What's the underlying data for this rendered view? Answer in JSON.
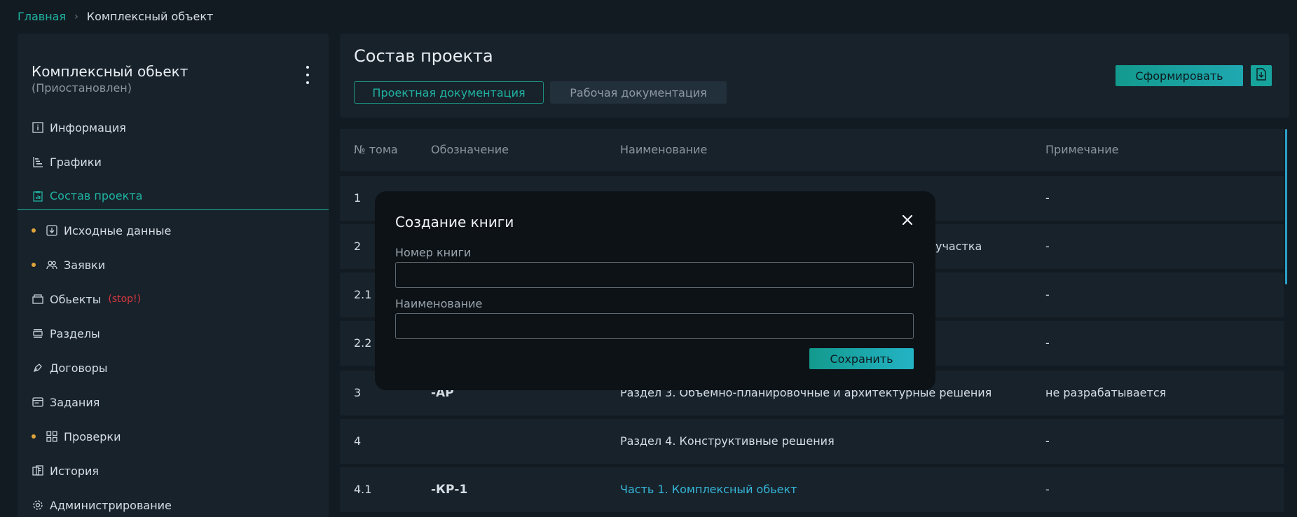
{
  "breadcrumb": {
    "home": "Главная",
    "separator": "›",
    "current": "Комплексный объект"
  },
  "sidebar": {
    "title": "Комплексный обьект",
    "status": "(Приостановлен)",
    "items": [
      {
        "label": "Информация",
        "icon": "info-icon"
      },
      {
        "label": "Графики",
        "icon": "gantt-icon"
      },
      {
        "label": "Состав проекта",
        "icon": "clipboard-icon",
        "active": true
      },
      {
        "label": "Исходные данные",
        "icon": "download-box-icon",
        "dot": true
      },
      {
        "label": "Заявки",
        "icon": "users-icon",
        "dot": true
      },
      {
        "label": "Обьекты",
        "icon": "box-icon",
        "badge": "(stop!)"
      },
      {
        "label": "Разделы",
        "icon": "sections-icon"
      },
      {
        "label": "Договоры",
        "icon": "pen-icon"
      },
      {
        "label": "Задания",
        "icon": "tasks-icon"
      },
      {
        "label": "Проверки",
        "icon": "grid-icon",
        "dot": true
      },
      {
        "label": "История",
        "icon": "history-icon"
      },
      {
        "label": "Администрирование",
        "icon": "gear-icon"
      }
    ]
  },
  "main": {
    "title": "Состав проекта",
    "tabs": [
      "Проектная документация",
      "Рабочая документация"
    ],
    "form_button": "Сформировать"
  },
  "table": {
    "headers": [
      "№ тома",
      "Обозначение",
      "Наименование",
      "Примечание"
    ],
    "rows": [
      {
        "num": "1",
        "code": "",
        "name": "",
        "note": "-"
      },
      {
        "num": "2",
        "code": "",
        "name": "участка",
        "note": "-"
      },
      {
        "num": "2.1",
        "code": "",
        "name": "",
        "note": "-"
      },
      {
        "num": "2.2",
        "code": "",
        "name": "",
        "note": "-"
      },
      {
        "num": "3",
        "code": "-АР",
        "name": "Раздел 3. Объемно-планировочные и архитектурные решения",
        "note": "не разрабатывается"
      },
      {
        "num": "4",
        "code": "",
        "name": "Раздел 4. Конструктивные решения",
        "note": "-"
      },
      {
        "num": "4.1",
        "code": "-КР-1",
        "name": "Часть 1. Комплексный обьект",
        "note": "-"
      }
    ]
  },
  "modal": {
    "title": "Создание книги",
    "field1_label": "Номер книги",
    "field1_value": "",
    "field2_label": "Наименование",
    "field2_value": "",
    "save": "Сохранить"
  },
  "colors": {
    "accent": "#1fb3a1",
    "link": "#36b6d8",
    "dot": "#e0a43a",
    "stop": "#d6383f"
  }
}
